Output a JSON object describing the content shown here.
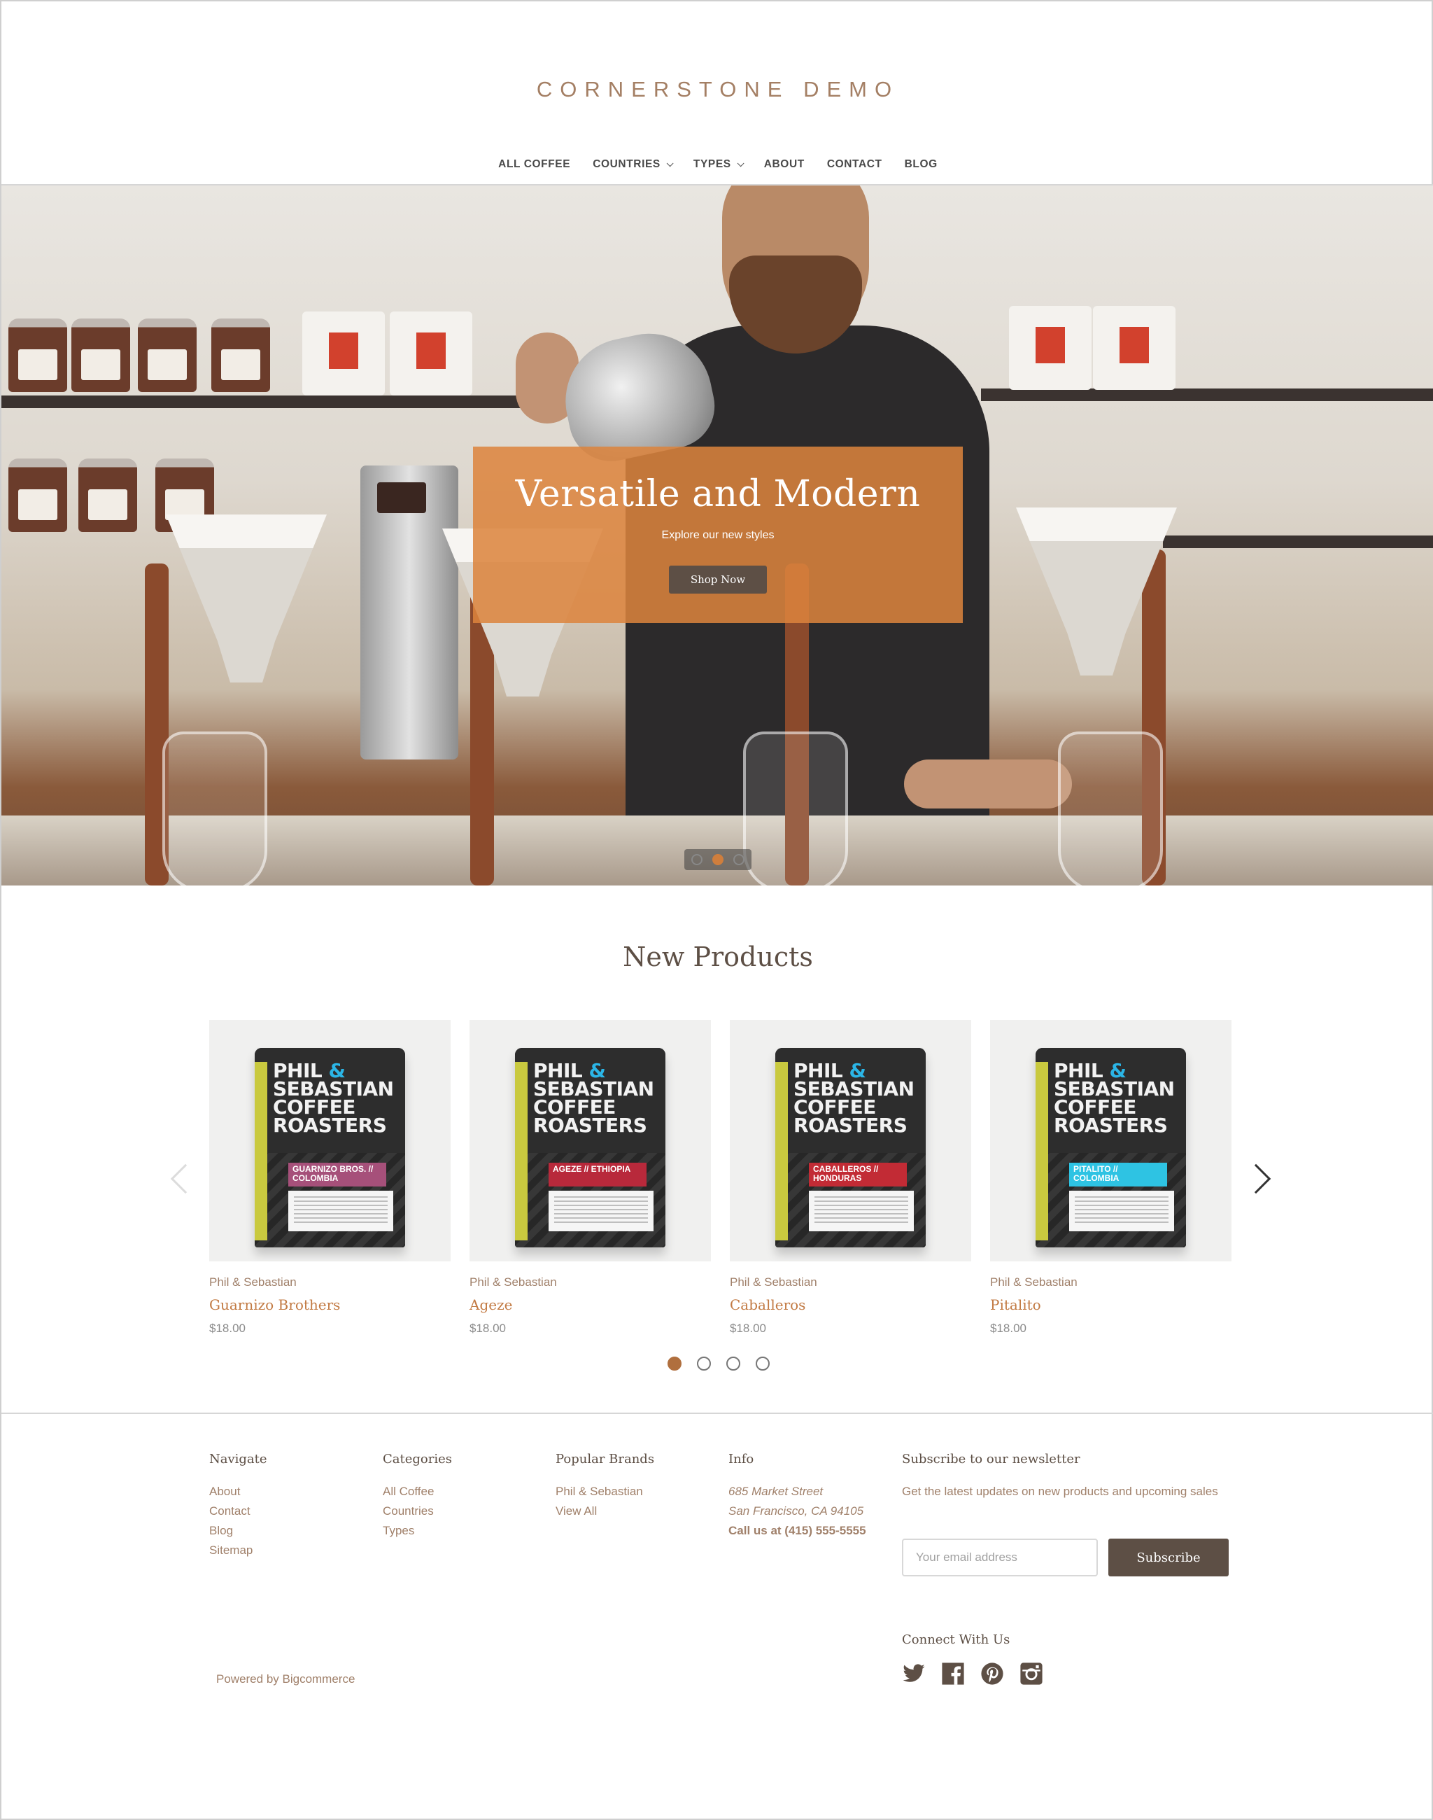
{
  "header": {
    "logo": "CORNERSTONE DEMO",
    "nav": [
      {
        "label": "ALL COFFEE",
        "dropdown": false
      },
      {
        "label": "COUNTRIES",
        "dropdown": true
      },
      {
        "label": "TYPES",
        "dropdown": true
      },
      {
        "label": "ABOUT",
        "dropdown": false
      },
      {
        "label": "CONTACT",
        "dropdown": false
      },
      {
        "label": "BLOG",
        "dropdown": false
      }
    ]
  },
  "hero": {
    "title": "Versatile and Modern",
    "subtitle": "Explore our new styles",
    "button": "Shop Now",
    "slides": 3,
    "active_slide": 2,
    "overlay_color": "#dc833c"
  },
  "new_products": {
    "title": "New Products",
    "items": [
      {
        "brand": "Phil & Sebastian",
        "name": "Guarnizo Brothers",
        "price": "$18.00",
        "bag_label": "GUARNIZO BROS. // COLOMBIA",
        "label_color": "#a6507a"
      },
      {
        "brand": "Phil & Sebastian",
        "name": "Ageze",
        "price": "$18.00",
        "bag_label": "AGEZE // ETHIOPIA",
        "label_color": "#b8293b"
      },
      {
        "brand": "Phil & Sebastian",
        "name": "Caballeros",
        "price": "$18.00",
        "bag_label": "CABALLEROS // HONDURAS",
        "label_color": "#c22b35"
      },
      {
        "brand": "Phil & Sebastian",
        "name": "Pitalito",
        "price": "$18.00",
        "bag_label": "PITALITO // COLOMBIA",
        "label_color": "#2ec3e3"
      }
    ],
    "bag_text": [
      "PHIL",
      "&",
      "SEBASTIAN",
      "COFFEE",
      "ROASTERS"
    ],
    "pages": 4,
    "active_page": 1
  },
  "footer": {
    "navigate": {
      "title": "Navigate",
      "links": [
        "About",
        "Contact",
        "Blog",
        "Sitemap"
      ]
    },
    "categories": {
      "title": "Categories",
      "links": [
        "All Coffee",
        "Countries",
        "Types"
      ]
    },
    "brands": {
      "title": "Popular Brands",
      "links": [
        "Phil & Sebastian",
        "View All"
      ]
    },
    "info": {
      "title": "Info",
      "address1": "685 Market Street",
      "address2": "San Francisco, CA 94105",
      "phone": "Call us at (415) 555-5555"
    },
    "newsletter": {
      "title": "Subscribe to our newsletter",
      "description": "Get the latest updates on new products and upcoming sales",
      "placeholder": "Your email address",
      "button": "Subscribe"
    },
    "connect": {
      "title": "Connect With Us",
      "icons": [
        "twitter-icon",
        "facebook-icon",
        "pinterest-icon",
        "instagram-icon"
      ]
    },
    "powered": "Powered by Bigcommerce"
  }
}
